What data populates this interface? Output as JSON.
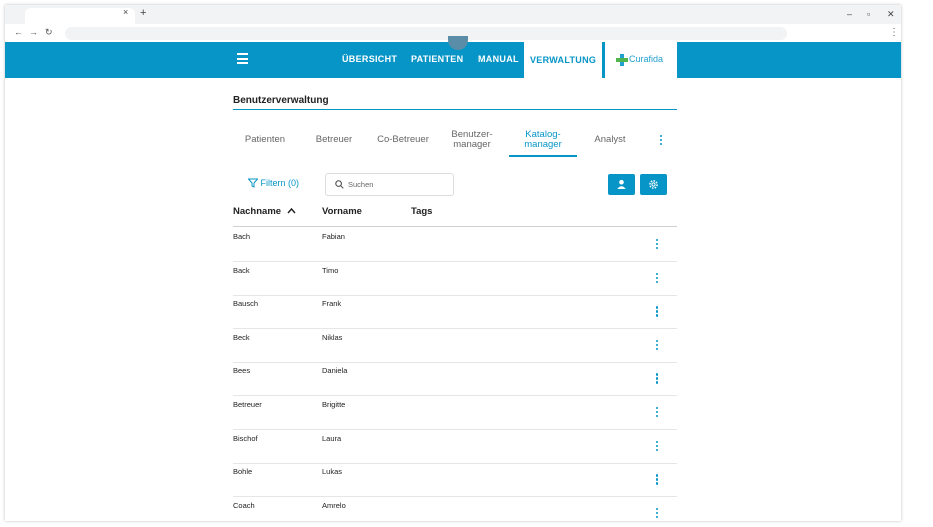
{
  "browser": {
    "tab_close": "×",
    "new_tab": "+",
    "window_controls": [
      "–",
      "▫",
      "✕"
    ],
    "nav": [
      "←",
      "→",
      "↻"
    ],
    "menu": "⋮"
  },
  "appbar": {
    "nav": [
      "ÜBERSICHT",
      "PATIENTEN",
      "MANUAL",
      "VERWALTUNG"
    ],
    "active": "VERWALTUNG",
    "logo_text": "Curafida",
    "color": "#0795c7"
  },
  "page": {
    "title": "Benutzerverwaltung",
    "subtabs": [
      {
        "line1": "Patienten",
        "line2": ""
      },
      {
        "line1": "Betreuer",
        "line2": ""
      },
      {
        "line1": "Co-Betreuer",
        "line2": ""
      },
      {
        "line1": "Benutzer-",
        "line2": "manager"
      },
      {
        "line1": "Katalog-",
        "line2": "manager"
      },
      {
        "line1": "Analyst",
        "line2": ""
      }
    ],
    "active_subtab": "Katalog-manager"
  },
  "toolbar": {
    "filter_label": "Filtern (0)",
    "search_placeholder": "Suchen",
    "add_user_icon": "add-person-icon",
    "settings_icon": "gear-icon"
  },
  "table": {
    "headers": [
      "Nachname",
      "Vorname",
      "Tags"
    ],
    "sort_indicator": "^",
    "rows": [
      {
        "nachname": "Bach",
        "vorname": "Fabian"
      },
      {
        "nachname": "Back",
        "vorname": "Timo"
      },
      {
        "nachname": "Bausch",
        "vorname": "Frank"
      },
      {
        "nachname": "Beck",
        "vorname": "Niklas"
      },
      {
        "nachname": "Bees",
        "vorname": "Daniela"
      },
      {
        "nachname": "Betreuer",
        "vorname": "Brigitte"
      },
      {
        "nachname": "Bischof",
        "vorname": "Laura"
      },
      {
        "nachname": "Bohle",
        "vorname": "Lukas"
      },
      {
        "nachname": "Coach",
        "vorname": "Amrelo"
      }
    ]
  }
}
